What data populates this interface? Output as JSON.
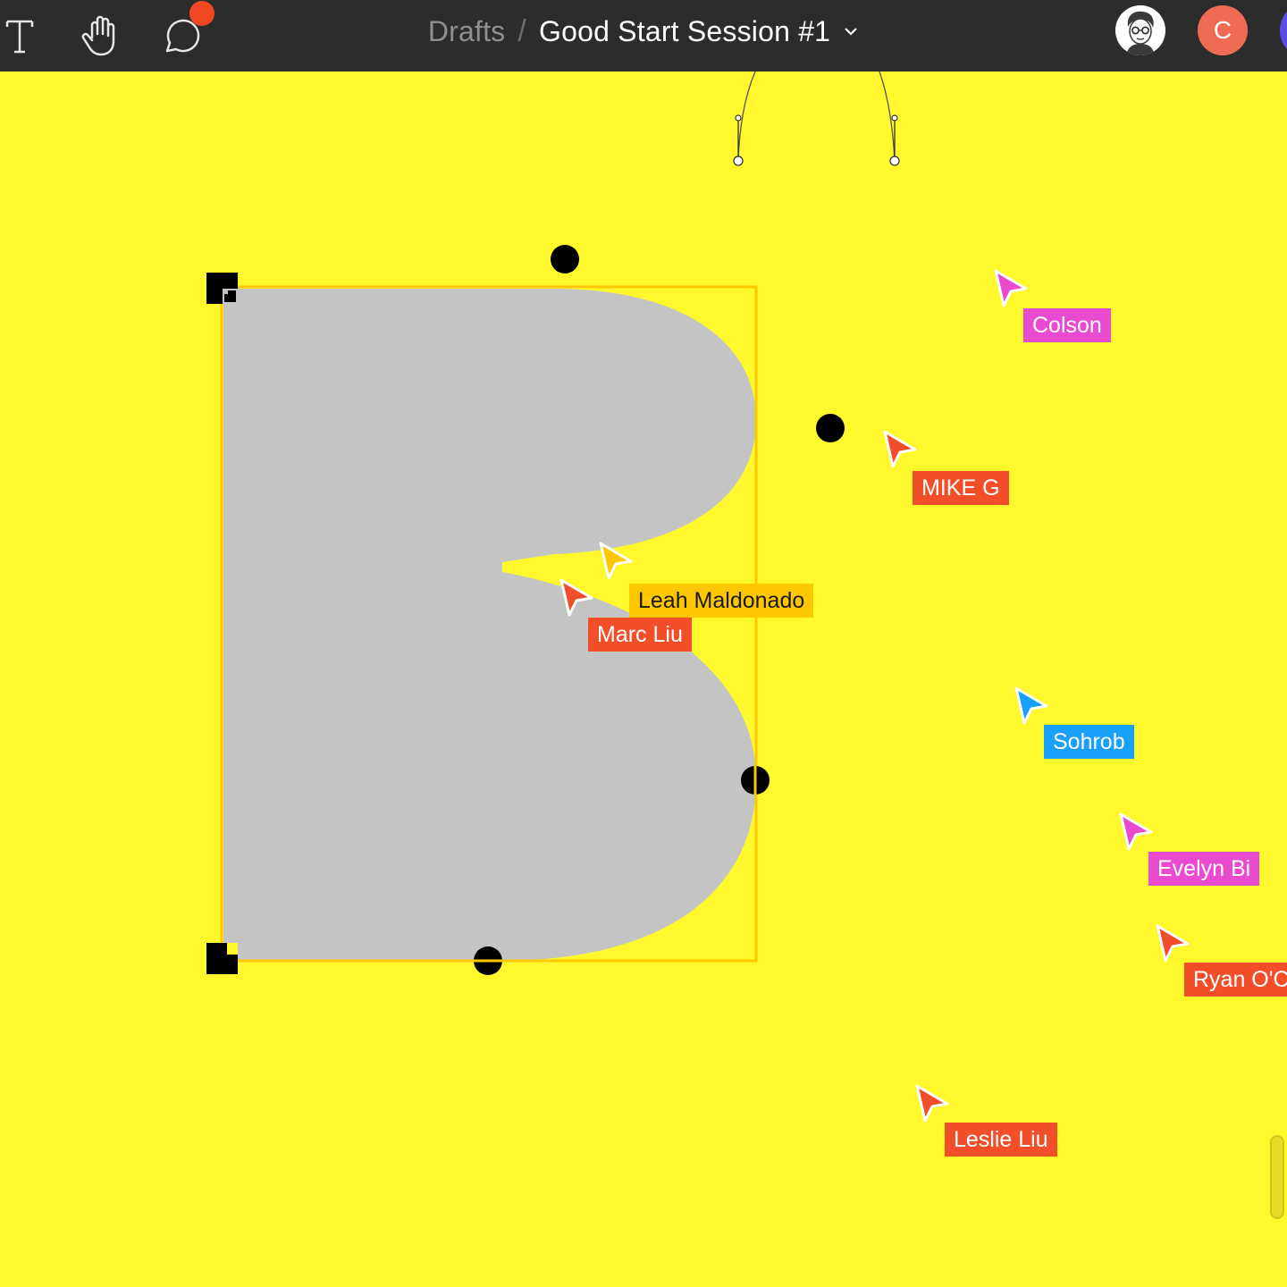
{
  "toolbar": {
    "text_tool_icon": "text-tool-icon",
    "hand_tool_icon": "hand-tool-icon",
    "comment_tool_icon": "comment-bubble-icon",
    "has_notification": true
  },
  "breadcrumb": {
    "parent": "Drafts",
    "separator": "/",
    "title": "Good Start Session #1"
  },
  "avatars": {
    "current_user_icon": "user-portrait-avatar",
    "second_user_initial": "C"
  },
  "colors": {
    "background": "#fff82d",
    "shape_fill": "#c4c4c4",
    "selection": "#ffc700",
    "topbar": "#2c2c2c"
  },
  "collaborators": [
    {
      "name": "Colson",
      "color": "#e84ad0"
    },
    {
      "name": "MIKE G",
      "color": "#f24e2a"
    },
    {
      "name": "Leah Maldonado",
      "color": "#ffc700"
    },
    {
      "name": "Marc Liu",
      "color": "#f24e2a"
    },
    {
      "name": "Sohrob",
      "color": "#18a0fb"
    },
    {
      "name": "Evelyn Bi",
      "color": "#e84ad0"
    },
    {
      "name": "Ryan O'C",
      "color": "#f24e2a"
    },
    {
      "name": "Leslie Liu",
      "color": "#f24e2a"
    }
  ]
}
